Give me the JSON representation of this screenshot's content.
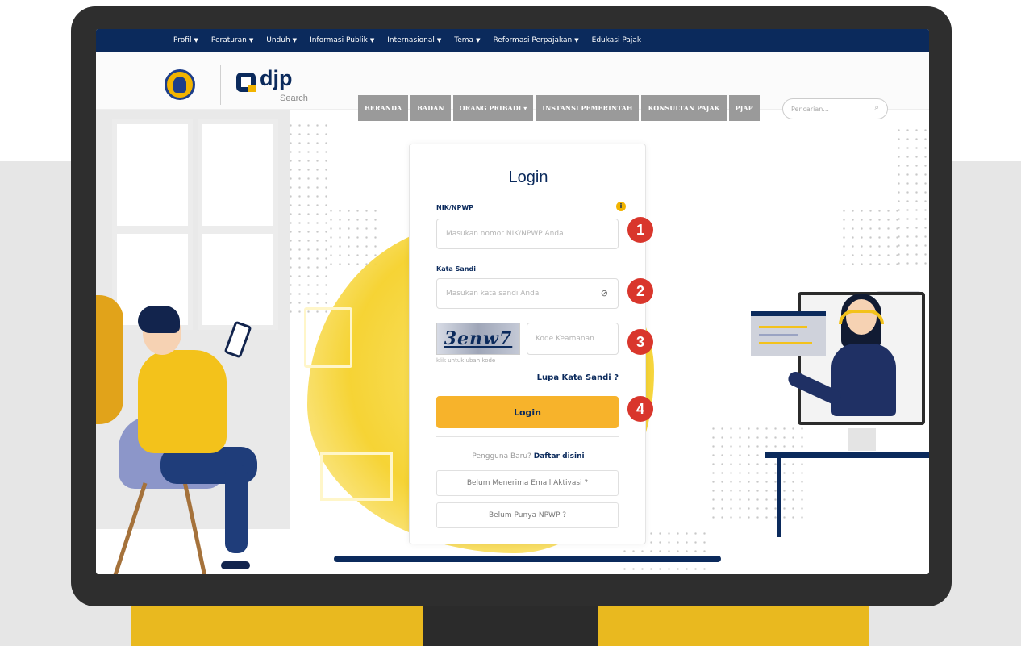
{
  "topnav": {
    "items": [
      {
        "label": "Profil",
        "has_caret": true
      },
      {
        "label": "Peraturan",
        "has_caret": true
      },
      {
        "label": "Unduh",
        "has_caret": true
      },
      {
        "label": "Informasi Publik",
        "has_caret": true
      },
      {
        "label": "Internasional",
        "has_caret": true
      },
      {
        "label": "Tema",
        "has_caret": true
      },
      {
        "label": "Reformasi Perpajakan",
        "has_caret": true
      },
      {
        "label": "Edukasi Pajak",
        "has_caret": false
      }
    ],
    "caret": "▼"
  },
  "header": {
    "logo_text": "djp",
    "logo_subtext": "Search",
    "menu": [
      "BERANDA",
      "BADAN",
      "ORANG PRIBADI ▾",
      "INSTANSI PEMERINTAH",
      "KONSULTAN PAJAK",
      "PJAP"
    ],
    "search_placeholder": "Pencarian..."
  },
  "login": {
    "title": "Login",
    "nik_label": "NIK/NPWP",
    "nik_placeholder": "Masukan nomor NIK/NPWP Anda",
    "password_label": "Kata Sandi",
    "password_placeholder": "Masukan kata sandi Anda",
    "captcha_text": "3enw7",
    "captcha_placeholder": "Kode Keamanan",
    "captcha_hint": "klik untuk ubah kode",
    "forgot": "Lupa Kata Sandi ?",
    "submit": "Login",
    "new_user_prefix": "Pengguna Baru?",
    "new_user_link": "Daftar disini",
    "activation_button": "Belum Menerima Email Aktivasi ?",
    "no_npwp_button": "Belum Punya NPWP ?"
  },
  "steps": [
    "1",
    "2",
    "3",
    "4"
  ],
  "icons": {
    "info": "i",
    "eye": "⊘",
    "search": "⌕"
  },
  "colors": {
    "navy": "#0b2a5c",
    "accent": "#f7b32b",
    "badge": "#d9362c",
    "stand": "#e9b91f"
  }
}
